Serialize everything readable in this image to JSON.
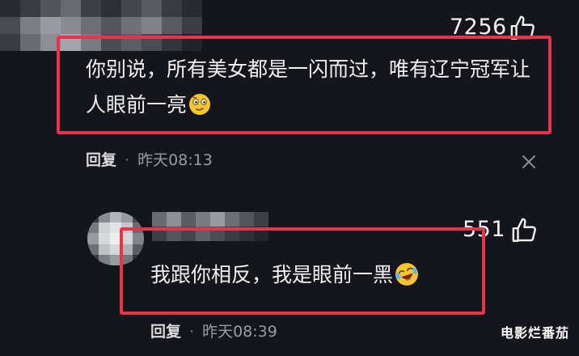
{
  "comments": [
    {
      "likes": "7256",
      "text": "你别说，所有美女都是一闪而过，唯有辽宁冠军让人眼前一亮",
      "emoji": "thinking-face-emoji",
      "reply_label": "回复",
      "time": "昨天08:13"
    },
    {
      "likes": "551",
      "text": "我跟你相反，我是眼前一黑",
      "emoji": "laughing-crying-face-emoji",
      "reply_label": "回复",
      "time": "昨天08:39"
    }
  ],
  "watermark": "电影烂番茄",
  "colors": {
    "background": "#15161b",
    "highlight_border": "#e8334a",
    "meta_text": "#9a9ba3"
  }
}
